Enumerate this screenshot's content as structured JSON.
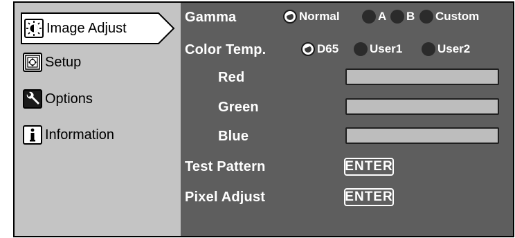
{
  "sidebar": {
    "items": [
      {
        "label": "Image Adjust",
        "icon": "brightness-icon"
      },
      {
        "label": "Setup",
        "icon": "setup-icon"
      },
      {
        "label": "Options",
        "icon": "wrench-icon"
      },
      {
        "label": "Information",
        "icon": "info-icon"
      }
    ]
  },
  "main": {
    "gamma": {
      "label": "Gamma",
      "options": [
        "Normal",
        "A",
        "B",
        "Custom"
      ],
      "selected": "Normal"
    },
    "color_temp": {
      "label": "Color Temp.",
      "options": [
        "D65",
        "User1",
        "User2"
      ],
      "selected": "D65"
    },
    "red": {
      "label": "Red"
    },
    "green": {
      "label": "Green"
    },
    "blue": {
      "label": "Blue"
    },
    "test_pattern": {
      "label": "Test Pattern",
      "button": "ENTER"
    },
    "pixel_adjust": {
      "label": "Pixel Adjust",
      "button": "ENTER"
    }
  },
  "colors": {
    "sidebar_bg": "#c4c4c4",
    "main_bg": "#5e5e5e",
    "text_main": "#ffffff",
    "radio_off": "#2b2b2b",
    "slider_fill": "#bdbdbd"
  }
}
